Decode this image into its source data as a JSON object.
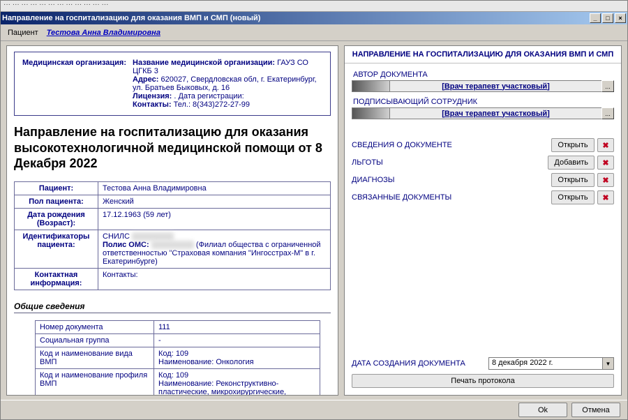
{
  "menubar_text": "··· ··· ··· ··· ··· ··· ··· ··· ··· ··· ··· ···",
  "window_title": "Направление на госпитализацию для оказания ВМП и СМП (новый)",
  "title_buttons": {
    "min": "_",
    "max": "□",
    "close": "×"
  },
  "patient_bar": {
    "label": "Пациент",
    "name": "Тестова Анна Владимировна"
  },
  "org": {
    "label": "Медицинская организация:",
    "name_label": "Название медицинской организации:",
    "name": "ГАУЗ СО ЦГКБ 3",
    "addr_label": "Адрес:",
    "addr": "620027, Свердловская обл, г. Екатеринбург, ул. Братьев Быковых, д. 16",
    "lic_label": "Лицензия:",
    "lic": ". Дата регистрации:",
    "cont_label": "Контакты:",
    "cont": "Тел.: 8(343)272-27-99"
  },
  "doc_title": "Направление на госпитализацию для оказания высокотехнологичной медицинской помощи от 8 Декабря 2022",
  "info": {
    "patient_l": "Пациент:",
    "patient_v": "Тестова Анна Владимировна",
    "sex_l": "Пол пациента:",
    "sex_v": "Женский",
    "dob_l": "Дата рождения (Возраст):",
    "dob_v": "17.12.1963 (59 лет)",
    "ids_l": "Идентификаторы пациента:",
    "ids_snils": "СНИЛС",
    "ids_polis": "Полис ОМС:",
    "ids_text": "(Филиал общества с ограниченной ответственностью \"Страховая компания \"Ингосстрах-М\" в г. Екатеринбурге)",
    "contact_l": "Контактная информация:",
    "contact_v": "Контакты:"
  },
  "section_general": "Общие сведения",
  "gen": {
    "num_l": "Номер документа",
    "num_v": "111",
    "soc_l": "Социальная группа",
    "soc_v": "-",
    "code_l": "Код и наименование вида ВМП",
    "code_code": "Код: 109",
    "code_name": "Наименование: Онкология",
    "prof_l": "Код и наименование профиля ВМП",
    "prof_code": "Код: 109",
    "prof_name": "Наименование: Реконструктивно-пластические, микрохирургические, обширные циторедуктивные, расширенно-"
  },
  "right": {
    "header": "НАПРАВЛЕНИЕ НА ГОСПИТАЛИЗАЦИЮ ДЛЯ ОКАЗАНИЯ ВМП И СМП",
    "author_label": "АВТОР ДОКУМЕНТА",
    "author_value": "[Врач терапевт участковый]",
    "signer_label": "ПОДПИСЫВАЮЩИЙ СОТРУДНИК",
    "signer_value": "[Врач терапевт участковый]",
    "rows": {
      "docinfo": {
        "label": "СВЕДЕНИЯ О ДОКУМЕНТЕ",
        "btn": "Открыть"
      },
      "benefits": {
        "label": "ЛЬГОТЫ",
        "btn": "Добавить"
      },
      "diag": {
        "label": "ДИАГНОЗЫ",
        "btn": "Открыть"
      },
      "linked": {
        "label": "СВЯЗАННЫЕ ДОКУМЕНТЫ",
        "btn": "Открыть"
      }
    },
    "date_label": "ДАТА СОЗДАНИЯ ДОКУМЕНТА",
    "date_value": "8 декабря 2022 г.",
    "print_btn": "Печать протокола",
    "picker_btn": "..."
  },
  "footer": {
    "ok": "Ok",
    "cancel": "Отмена"
  }
}
